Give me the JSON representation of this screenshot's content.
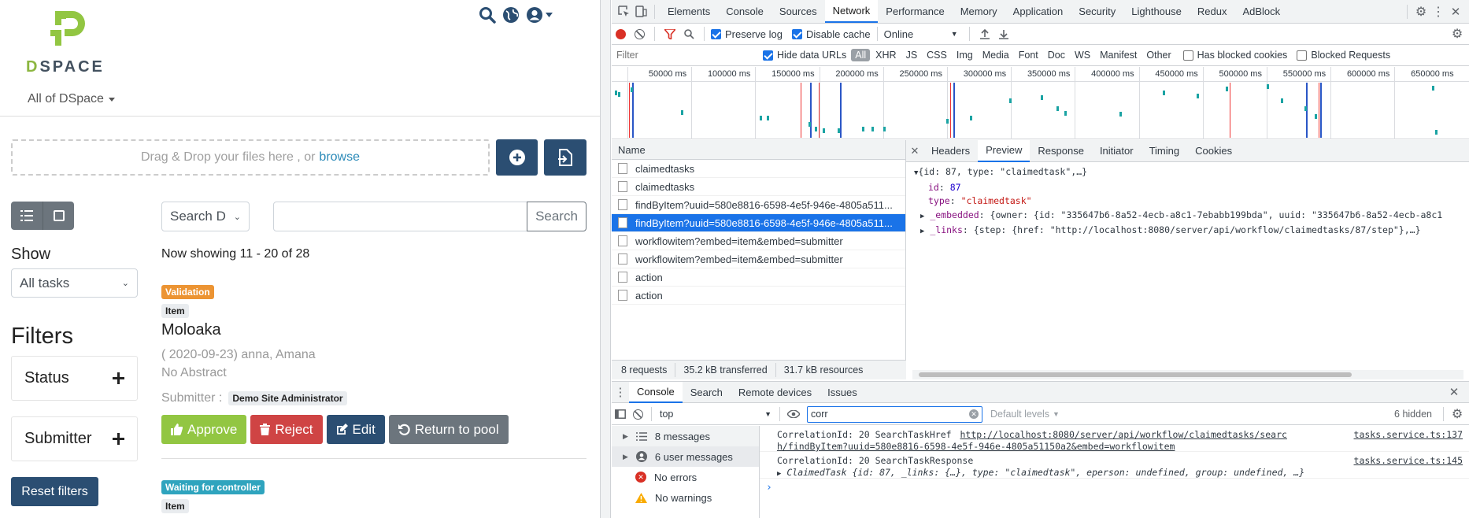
{
  "dspace": {
    "logo_text_a": "D",
    "logo_text_b": "SPACE",
    "scope_label": "All of DSpace",
    "dropzone_text": "Drag & Drop your files here , or",
    "dropzone_link": "browse",
    "search_scope": "Search D",
    "search_placeholder": "",
    "search_button": "Search",
    "show_label": "Show",
    "show_value": "All tasks",
    "filters_title": "Filters",
    "facets": [
      {
        "label": "Status"
      },
      {
        "label": "Submitter"
      }
    ],
    "reset_label": "Reset filters",
    "showing_text": "Now showing 11 - 20 of 28",
    "item1": {
      "status_badge": "Validation",
      "type_badge": "Item",
      "title": "Moloaka",
      "meta": "( 2020-09-23) anna, Amana",
      "abstract": "No Abstract",
      "submitter_label": "Submitter :",
      "submitter_value": "Demo Site Administrator",
      "approve": "Approve",
      "reject": "Reject",
      "edit": "Edit",
      "return_pool": "Return to pool"
    },
    "item2": {
      "status_badge": "Waiting for controller",
      "type_badge": "Item"
    },
    "colors": {
      "primary": "#2b4e72",
      "success": "#92c642",
      "danger": "#cf4444",
      "secondary": "#6c757d",
      "warning": "#ec9433",
      "info": "#2fa4be",
      "link": "#2b8ab8"
    }
  },
  "devtools": {
    "tabs": [
      "Elements",
      "Console",
      "Sources",
      "Network",
      "Performance",
      "Memory",
      "Application",
      "Security",
      "Lighthouse",
      "Redux",
      "AdBlock"
    ],
    "active_tab": "Network",
    "toolbar": {
      "preserve_log": "Preserve log",
      "disable_cache": "Disable cache",
      "throttle": "Online"
    },
    "filter_bar": {
      "placeholder": "Filter",
      "hide_data_urls": "Hide data URLs",
      "types": [
        "All",
        "XHR",
        "JS",
        "CSS",
        "Img",
        "Media",
        "Font",
        "Doc",
        "WS",
        "Manifest",
        "Other"
      ],
      "has_blocked": "Has blocked cookies",
      "blocked_requests": "Blocked Requests"
    },
    "timeline_ticks": [
      "50000 ms",
      "100000 ms",
      "150000 ms",
      "200000 ms",
      "250000 ms",
      "300000 ms",
      "350000 ms",
      "400000 ms",
      "450000 ms",
      "500000 ms",
      "550000 ms",
      "600000 ms",
      "650000 ms"
    ],
    "requests_header": "Name",
    "requests": [
      "claimedtasks",
      "claimedtasks",
      "findByItem?uuid=580e8816-6598-4e5f-946e-4805a511...",
      "findByItem?uuid=580e8816-6598-4e5f-946e-4805a511...",
      "workflowitem?embed=item&embed=submitter",
      "workflowitem?embed=item&embed=submitter",
      "action",
      "action"
    ],
    "selected_request": 3,
    "summary": {
      "requests": "8 requests",
      "transferred": "35.2 kB transferred",
      "resources": "31.7 kB resources"
    },
    "preview_tabs": [
      "Headers",
      "Preview",
      "Response",
      "Initiator",
      "Timing",
      "Cookies"
    ],
    "active_preview_tab": "Preview",
    "preview": {
      "root": "{id: 87, type: \"claimedtask\",…}",
      "id_key": "id",
      "id_val": "87",
      "type_key": "type",
      "type_val": "\"claimedtask\"",
      "embedded_key": "_embedded",
      "embedded_val": "{owner: {id: \"335647b6-8a52-4ecb-a8c1-7ebabb199bda\", uuid: \"335647b6-8a52-4ecb-a8c1",
      "links_key": "_links",
      "links_val": "{step: {href: \"http://localhost:8080/server/api/workflow/claimedtasks/87/step\"},…}"
    },
    "drawer_tabs": [
      "Console",
      "Search",
      "Remote devices",
      "Issues"
    ],
    "console_toolbar": {
      "context": "top",
      "filter_value": "corr",
      "levels": "Default levels",
      "hidden": "6 hidden"
    },
    "console_sidebar": [
      {
        "label": "8 messages",
        "icon": "list-icon"
      },
      {
        "label": "6 user messages",
        "icon": "user-icon"
      },
      {
        "label": "No errors",
        "icon": "error-icon"
      },
      {
        "label": "No warnings",
        "icon": "warning-icon"
      }
    ],
    "messages": [
      {
        "text": "CorrelationId: 20 SearchTaskHref",
        "link1": "http://localhost:8080/server/api/workflow/claimedtasks/searc",
        "link2": "h/findByItem?uuid=580e8816-6598-4e5f-946e-4805a51150a2&embed=workflowitem",
        "source": "tasks.service.ts:137"
      },
      {
        "text": "CorrelationId: 20 SearchTaskResponse",
        "obj_prefix": "ClaimedTask",
        "obj_body": "{id: 87, _links: {…}, type: \"claimedtask\", eperson: undefined, group: undefined, …}",
        "source": "tasks.service.ts:145"
      }
    ]
  }
}
